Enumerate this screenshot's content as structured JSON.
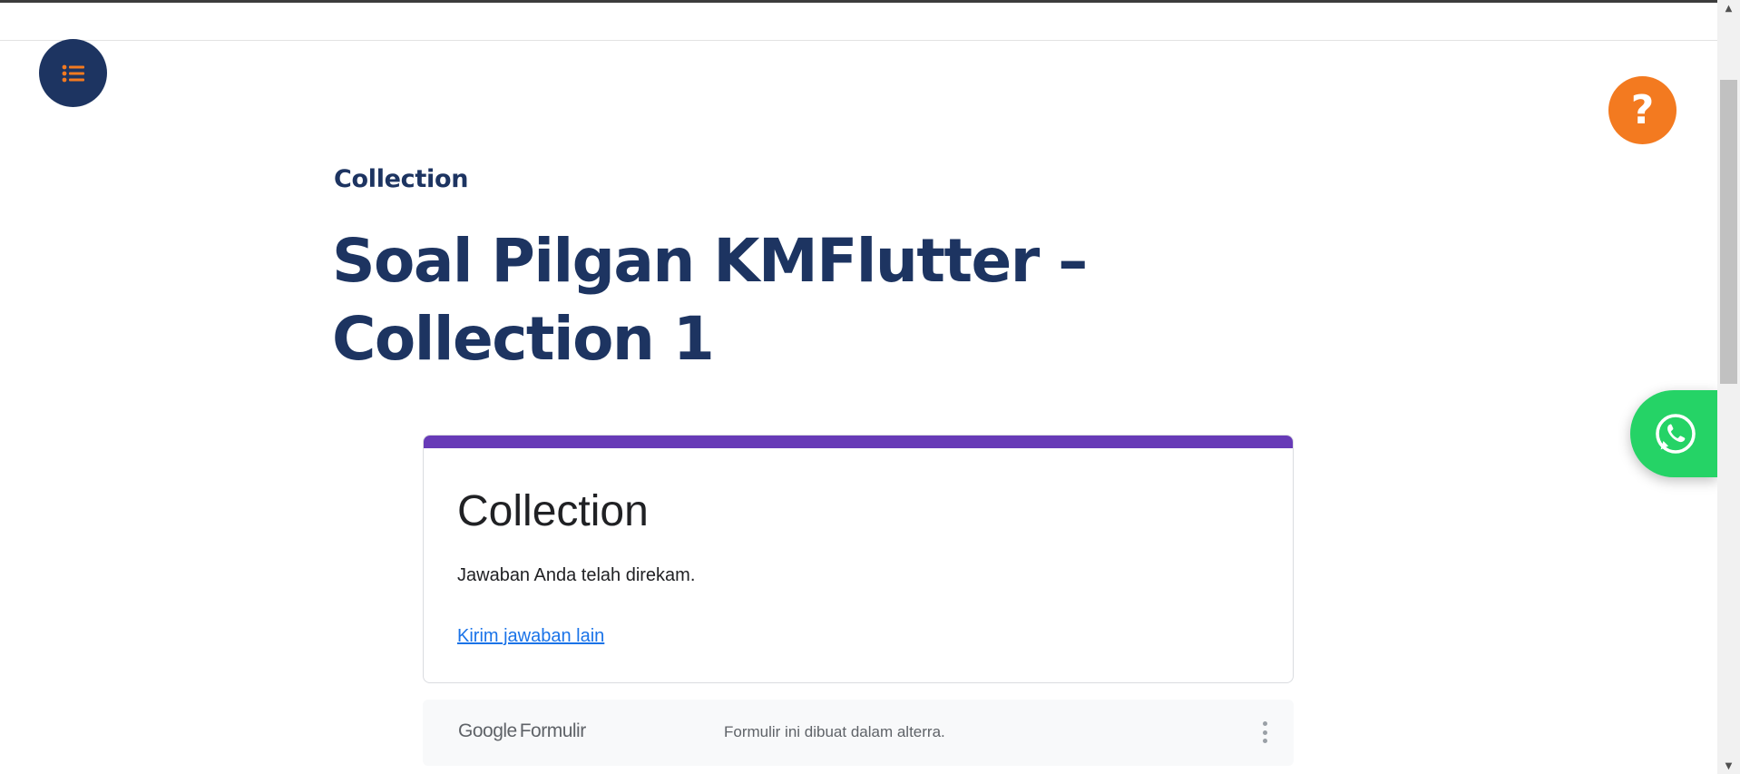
{
  "header": {
    "category": "Collection",
    "title": "Soal Pilgan KMFlutter – Collection 1"
  },
  "fabs": {
    "menu_icon": "list-icon",
    "help_icon": "question-icon",
    "help_glyph": "?",
    "whatsapp_icon": "whatsapp-icon"
  },
  "form": {
    "accent_color": "#673ab7",
    "title": "Collection",
    "message": "Jawaban Anda telah direkam.",
    "link_label": "Kirim jawaban lain"
  },
  "footer": {
    "logo_google": "Google",
    "logo_product": "Formulir",
    "note": "Formulir ini dibuat dalam alterra.",
    "more_icon": "more-vertical-icon"
  },
  "colors": {
    "navy": "#1d3461",
    "orange": "#f37a20",
    "whatsapp_green": "#25d366",
    "link_blue": "#1a73e8"
  }
}
